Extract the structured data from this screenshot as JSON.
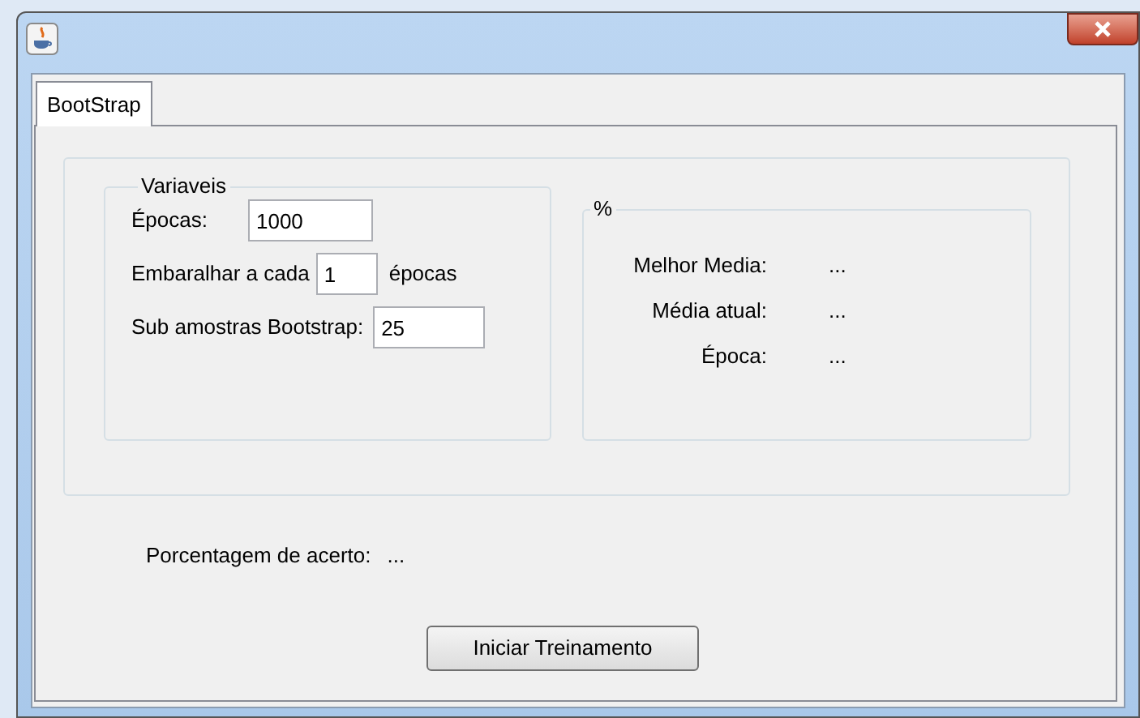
{
  "tabs": [
    {
      "label": "BootStrap",
      "selected": true
    }
  ],
  "variables_group": {
    "title": "Variaveis",
    "rows": [
      {
        "kind": "field",
        "label": "Épocas:",
        "value": "1000"
      },
      {
        "kind": "inline",
        "label": "Embaralhar a cada",
        "value": "1",
        "suffix": "épocas"
      },
      {
        "kind": "field",
        "label": "Sub amostras Bootstrap:",
        "value": "25"
      }
    ]
  },
  "percent_group": {
    "title": "%",
    "rows": [
      {
        "label": "Melhor Media:",
        "value": "..."
      },
      {
        "label": "Média atual:",
        "value": "..."
      },
      {
        "label": "Época:",
        "value": "..."
      }
    ]
  },
  "accuracy": {
    "label": "Porcentagem de acerto:",
    "value": "..."
  },
  "buttons": [
    "Iniciar Treinamento"
  ]
}
